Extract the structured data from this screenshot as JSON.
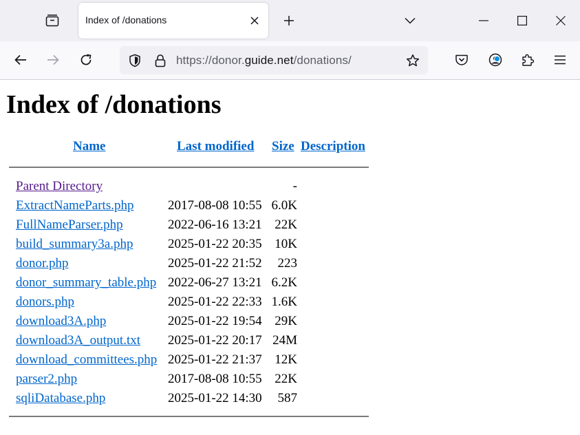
{
  "browser": {
    "tab_title": "Index of /donations",
    "url_prefix": "https://donor.",
    "url_host": "guide.net",
    "url_path": "/donations/",
    "accent_color": "#0090ed"
  },
  "page": {
    "heading": "Index of /donations",
    "columns": {
      "name": "Name",
      "last_modified": "Last modified",
      "size": "Size",
      "description": "Description"
    },
    "link_color": "#0066cc",
    "visited_color": "#551a8b",
    "rows": [
      {
        "name": "Parent Directory",
        "modified": "",
        "size": "-"
      },
      {
        "name": "ExtractNameParts.php",
        "modified": "2017-08-08 10:55",
        "size": "6.0K"
      },
      {
        "name": "FullNameParser.php",
        "modified": "2022-06-16 13:21",
        "size": "22K"
      },
      {
        "name": "build_summary3a.php",
        "modified": "2025-01-22 20:35",
        "size": "10K"
      },
      {
        "name": "donor.php",
        "modified": "2025-01-22 21:52",
        "size": "223"
      },
      {
        "name": "donor_summary_table.php",
        "modified": "2022-06-27 13:21",
        "size": "6.2K"
      },
      {
        "name": "donors.php",
        "modified": "2025-01-22 22:33",
        "size": "1.6K"
      },
      {
        "name": "download3A.php",
        "modified": "2025-01-22 19:54",
        "size": "29K"
      },
      {
        "name": "download3A_output.txt",
        "modified": "2025-01-22 20:17",
        "size": "24M"
      },
      {
        "name": "download_committees.php",
        "modified": "2025-01-22 21:37",
        "size": "12K"
      },
      {
        "name": "parser2.php",
        "modified": "2017-08-08 10:55",
        "size": "22K"
      },
      {
        "name": "sqliDatabase.php",
        "modified": "2025-01-22 14:30",
        "size": "587"
      }
    ]
  },
  "icons": {
    "tab_list": "tab-list-icon",
    "close_tab": "close-icon",
    "new_tab": "plus-icon",
    "overflow": "chevron-down-icon",
    "minimize": "minimize-icon",
    "maximize": "maximize-icon",
    "close_window": "close-window-icon",
    "back": "back-arrow-icon",
    "forward": "forward-arrow-icon",
    "reload": "reload-icon",
    "tracking": "shield-icon",
    "lock": "lock-icon",
    "bookmark": "star-icon",
    "pocket": "pocket-icon",
    "account": "account-icon",
    "extensions": "puzzle-icon",
    "menu": "hamburger-menu-icon"
  }
}
